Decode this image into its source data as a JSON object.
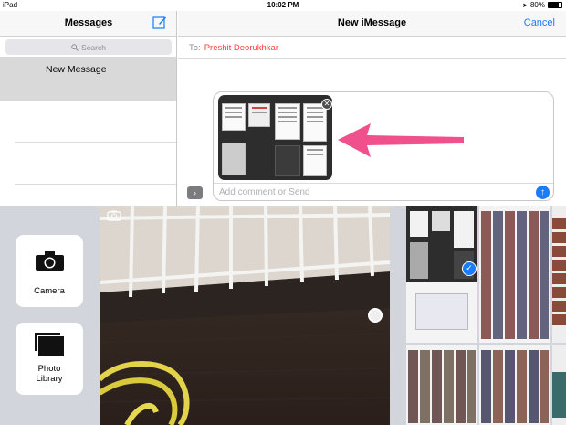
{
  "status_bar": {
    "device": "iPad",
    "time": "10:02 PM",
    "battery_percent": "80%",
    "battery_level": 0.8
  },
  "sidebar": {
    "title": "Messages",
    "search_placeholder": "Search",
    "items": [
      {
        "label": "New Message"
      }
    ]
  },
  "conversation": {
    "title": "New iMessage",
    "cancel_label": "Cancel",
    "to_label": "To:",
    "recipient": "Preshit Deorukhkar",
    "comment_placeholder": "Add comment or Send"
  },
  "picker": {
    "camera_label": "Camera",
    "library_label_line1": "Photo",
    "library_label_line2": "Library"
  },
  "colors": {
    "accent": "#1a7cf7",
    "annotation_arrow": "#f0508c",
    "recipient": "#ff3b3b"
  },
  "icons": {
    "compose": "compose-icon",
    "search": "search-icon",
    "remove": "close-icon",
    "send": "arrow-up-icon",
    "expand": "chevron-right-icon",
    "camera": "camera-icon",
    "library": "photo-library-icon",
    "flip": "flip-camera-icon",
    "check": "checkmark-icon"
  }
}
